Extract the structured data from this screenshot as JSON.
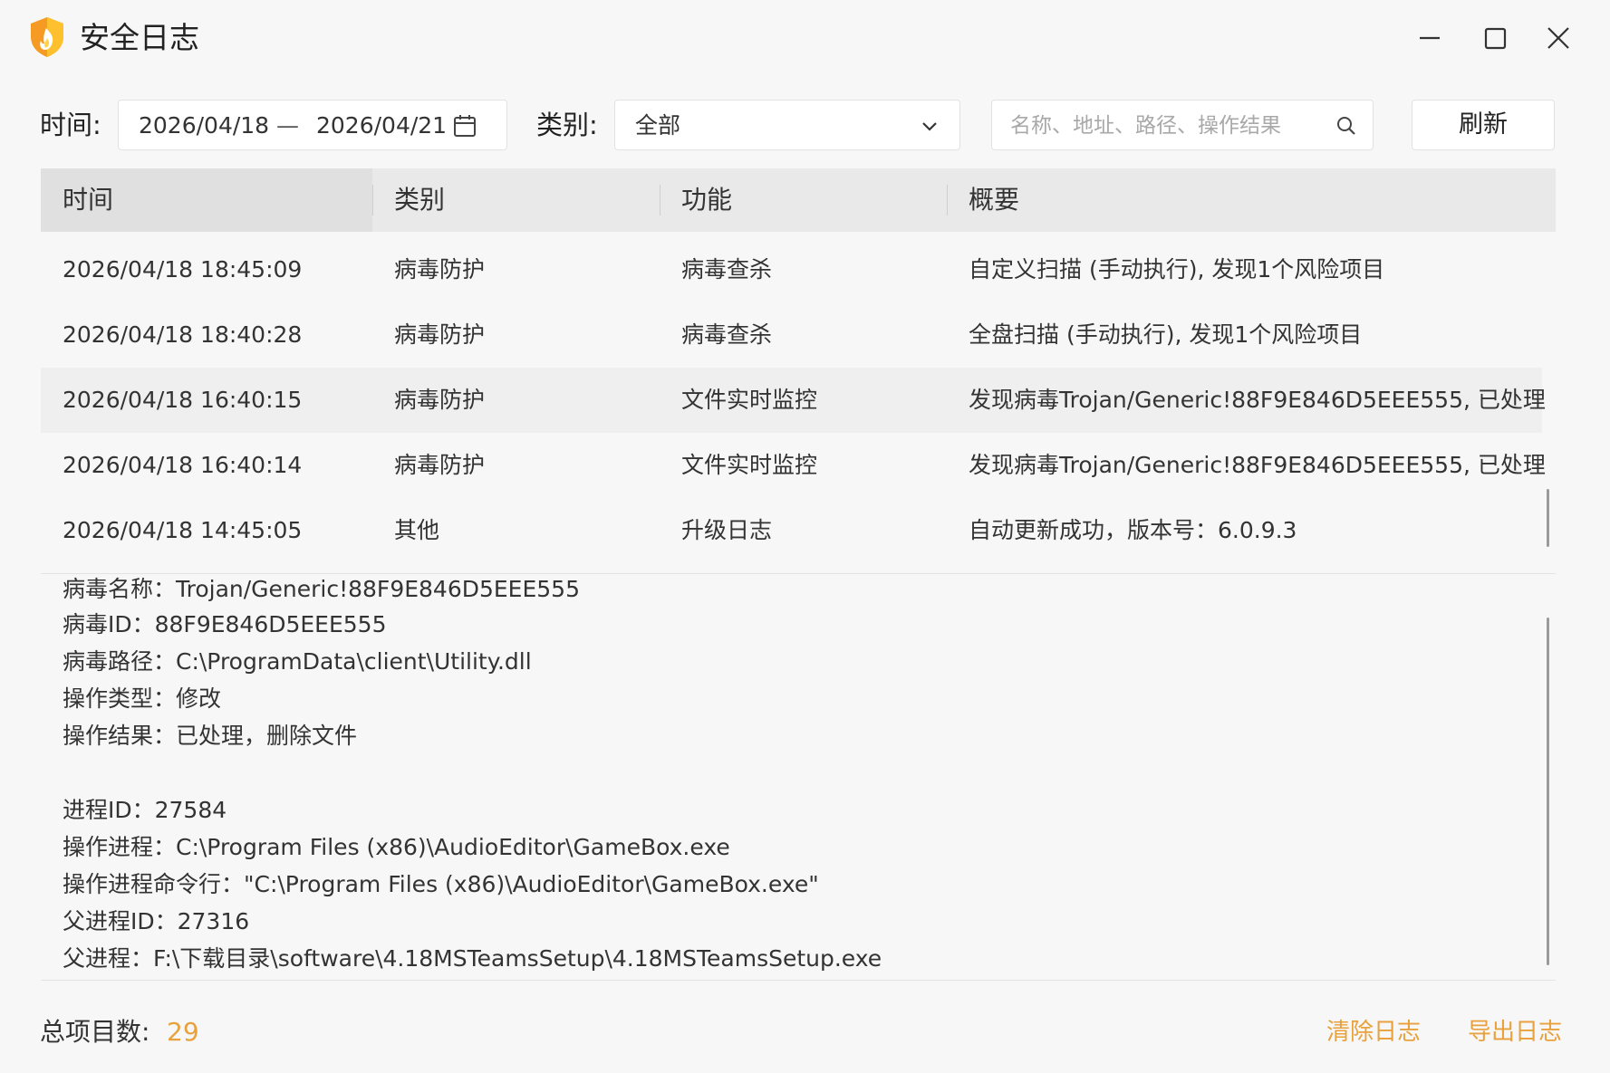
{
  "window": {
    "title": "安全日志"
  },
  "filters": {
    "time_label": "时间:",
    "date_from": "2026/04/18",
    "date_sep": "—",
    "date_to": "2026/04/21",
    "category_label": "类别:",
    "category_value": "全部",
    "search_placeholder": "名称、地址、路径、操作结果",
    "search_value": "",
    "refresh_label": "刷新"
  },
  "table": {
    "headers": [
      "时间",
      "类别",
      "功能",
      "概要"
    ],
    "rows": [
      {
        "time": "2026/04/18 18:45:09",
        "category": "病毒防护",
        "function": "病毒查杀",
        "summary": "自定义扫描 (手动执行), 发现1个风险项目"
      },
      {
        "time": "2026/04/18 18:40:28",
        "category": "病毒防护",
        "function": "病毒查杀",
        "summary": "全盘扫描 (手动执行), 发现1个风险项目"
      },
      {
        "time": "2026/04/18 16:40:15",
        "category": "病毒防护",
        "function": "文件实时监控",
        "summary": "发现病毒Trojan/Generic!88F9E846D5EEE555, 已处理"
      },
      {
        "time": "2026/04/18 16:40:14",
        "category": "病毒防护",
        "function": "文件实时监控",
        "summary": "发现病毒Trojan/Generic!88F9E846D5EEE555, 已处理"
      },
      {
        "time": "2026/04/18 14:45:05",
        "category": "其他",
        "function": "升级日志",
        "summary": "自动更新成功，版本号：6.0.9.3"
      }
    ],
    "selected_row": 2
  },
  "detail": {
    "lines": [
      "病毒名称：Trojan/Generic!88F9E846D5EEE555",
      "病毒ID：88F9E846D5EEE555",
      "病毒路径：C:\\ProgramData\\client\\Utility.dll",
      "操作类型：修改",
      "操作结果：已处理，删除文件",
      "",
      "进程ID：27584",
      "操作进程：C:\\Program Files (x86)\\AudioEditor\\GameBox.exe",
      "操作进程命令行：\"C:\\Program Files (x86)\\AudioEditor\\GameBox.exe\"",
      "父进程ID：27316",
      "父进程：F:\\下载目录\\software\\4.18MSTeamsSetup\\4.18MSTeamsSetup.exe"
    ]
  },
  "footer": {
    "total_label": "总项目数:",
    "total_count": "29",
    "clear_label": "清除日志",
    "export_label": "导出日志"
  },
  "colors": {
    "accent": "#e8a13d",
    "logo_orange": "#f59a23",
    "logo_yellow": "#ffd34a"
  },
  "icons": {
    "logo": "shield-flame-icon",
    "minimize": "minimize-icon",
    "maximize": "maximize-icon",
    "close": "close-icon",
    "calendar": "calendar-icon",
    "dropdown": "chevron-down-icon",
    "search": "search-icon"
  }
}
